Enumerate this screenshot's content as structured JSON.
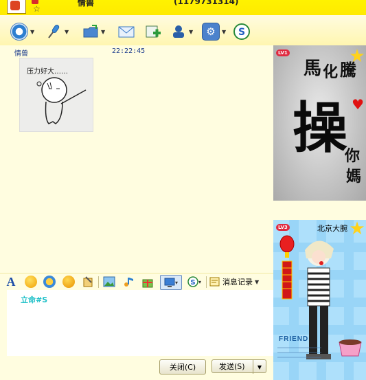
{
  "titlebar": {
    "name": "情兽",
    "id_text": "(1179731314)"
  },
  "toolbar": {
    "buttons": [
      {
        "name": "video-button",
        "icon": "webcam-icon",
        "color": "#2d7fd0",
        "has_menu": true
      },
      {
        "name": "voice-button",
        "icon": "microphone-icon",
        "color": "#3b8ad8",
        "has_menu": true
      },
      {
        "name": "send-file-button",
        "icon": "folder-icon",
        "color": "#2e6fbf",
        "has_menu": true
      },
      {
        "name": "send-mail-button",
        "icon": "mail-icon",
        "color": "#3879c7",
        "has_menu": false
      },
      {
        "name": "create-group-button",
        "icon": "group-add-icon",
        "color": "#2d9a3c",
        "has_menu": false
      },
      {
        "name": "remote-assist-button",
        "icon": "user-icon",
        "color": "#2a5fa8",
        "has_menu": true
      },
      {
        "name": "apps-button",
        "icon": "gear-icon",
        "color": "#4b82cc",
        "has_menu": true
      },
      {
        "name": "soso-button",
        "icon": "soso-icon",
        "color": "#e33a2b",
        "has_menu": false
      }
    ]
  },
  "chat": {
    "messages": [
      {
        "sender": "情兽",
        "time": "22:22:45",
        "sticker_caption": "压力好大……"
      }
    ]
  },
  "format_bar": {
    "font_icon": "A",
    "history_label": "消息记录"
  },
  "input": {
    "text": "立命#S"
  },
  "buttons": {
    "close": "关闭(C)",
    "send": "发送(S)"
  },
  "show_panel": {
    "level_badge": "LV1",
    "level_star": "LV1",
    "calligraphy": [
      "馬",
      "化",
      "騰",
      "操",
      "你",
      "媽"
    ]
  },
  "avatar_panel": {
    "level_badge": "LV3",
    "level_star": "LV1",
    "name": "北京大腕",
    "friend_text": "FRIEND"
  }
}
